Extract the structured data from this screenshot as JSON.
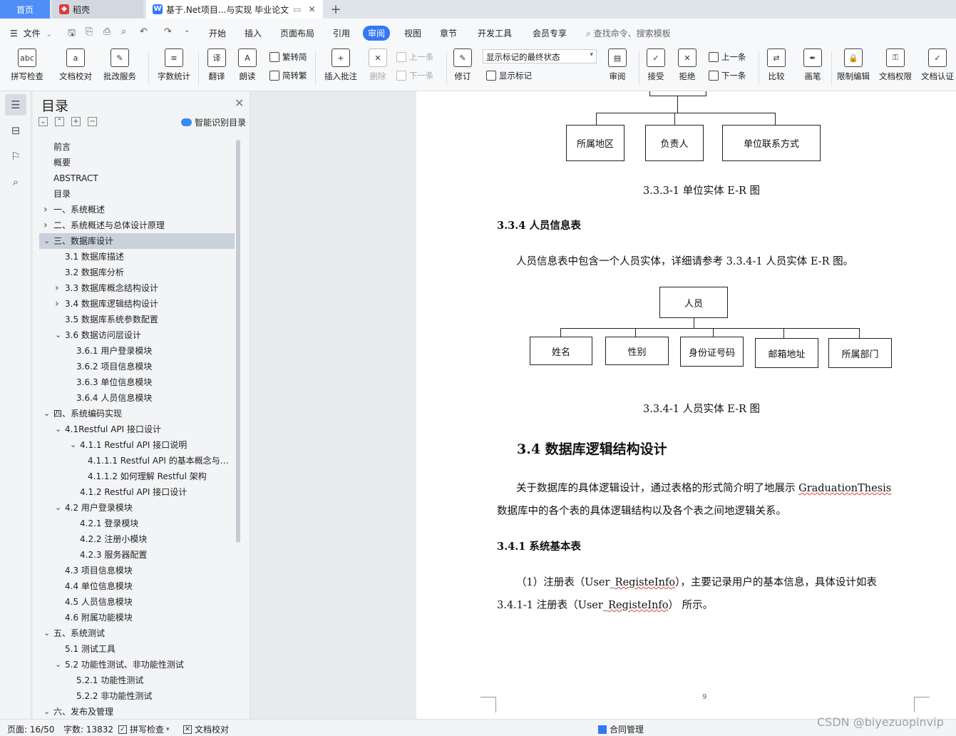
{
  "tabs": {
    "home": "首页",
    "daoke": "稻壳",
    "doc": "基于.Net项目...与实现 毕业论文",
    "new_tab": "+"
  },
  "menu": {
    "file": "文件",
    "items": [
      "开始",
      "插入",
      "页面布局",
      "引用",
      "审阅",
      "视图",
      "章节",
      "开发工具",
      "会员专享"
    ],
    "search": "查找命令、搜索模板"
  },
  "ribbon": {
    "spell": "拼写检查",
    "proof": "文档校对",
    "batch": "批改服务",
    "wordcount": "字数统计",
    "translate": "翻译",
    "read": "朗读",
    "to_simplified": "繁转简",
    "to_traditional": "简转繁",
    "insert_comment": "插入批注",
    "delete": "删除",
    "prev_comment": "上一条",
    "next_comment": "下一条",
    "revise": "修订",
    "markup_state": "显示标记的最终状态",
    "show_markup": "显示标记",
    "review": "审阅",
    "accept": "接受",
    "reject": "拒绝",
    "prev": "上一条",
    "next": "下一条",
    "compare": "比较",
    "pen": "画笔",
    "restrict_edit": "限制编辑",
    "doc_permission": "文档权限",
    "doc_cert": "文档认证"
  },
  "toc": {
    "title": "目录",
    "smart": "智能识别目录",
    "items": [
      {
        "label": "前言",
        "level": 0,
        "chev": ""
      },
      {
        "label": "概要",
        "level": 0,
        "chev": ""
      },
      {
        "label": "ABSTRACT",
        "level": 0,
        "chev": ""
      },
      {
        "label": "目录",
        "level": 0,
        "chev": ""
      },
      {
        "label": "一、系统概述",
        "level": 0,
        "chev": "right"
      },
      {
        "label": "二、系统概述与总体设计原理",
        "level": 0,
        "chev": "right"
      },
      {
        "label": "三、数据库设计",
        "level": 0,
        "chev": "down",
        "selected": true
      },
      {
        "label": "3.1 数据库描述",
        "level": 1,
        "chev": ""
      },
      {
        "label": "3.2 数据库分析",
        "level": 1,
        "chev": ""
      },
      {
        "label": "3.3 数据库概念结构设计",
        "level": 1,
        "chev": "right"
      },
      {
        "label": "3.4 数据库逻辑结构设计",
        "level": 1,
        "chev": "right"
      },
      {
        "label": "3.5 数据库系统参数配置",
        "level": 1,
        "chev": ""
      },
      {
        "label": "3.6 数据访问层设计",
        "level": 1,
        "chev": "down"
      },
      {
        "label": "3.6.1  用户登录模块",
        "level": 2,
        "chev": ""
      },
      {
        "label": "3.6.2  项目信息模块",
        "level": 2,
        "chev": ""
      },
      {
        "label": "3.6.3  单位信息模块",
        "level": 2,
        "chev": ""
      },
      {
        "label": "3.6.4  人员信息模块",
        "level": 2,
        "chev": ""
      },
      {
        "label": "四、系统编码实现",
        "level": 0,
        "chev": "down"
      },
      {
        "label": "4.1Restful API 接口设计",
        "level": 1,
        "chev": "down"
      },
      {
        "label": "4.1.1 Restful API 接口说明",
        "level": 2,
        "chev": "down",
        "shift": true
      },
      {
        "label": "4.1.1.1 Restful API 的基本概念与…",
        "level": 3,
        "chev": ""
      },
      {
        "label": "4.1.1.2  如何理解 Restful 架构",
        "level": 3,
        "chev": ""
      },
      {
        "label": "4.1.2 Restful API 接口设计",
        "level": 2,
        "chev": "",
        "shift": true
      },
      {
        "label": "4.2 用户登录模块",
        "level": 1,
        "chev": "down"
      },
      {
        "label": "4.2.1 登录模块",
        "level": 2,
        "chev": "",
        "shift": true
      },
      {
        "label": "4.2.2 注册小模块",
        "level": 2,
        "chev": "",
        "shift": true
      },
      {
        "label": "4.2.3 服务器配置",
        "level": 2,
        "chev": "",
        "shift": true
      },
      {
        "label": "4.3 项目信息模块",
        "level": 1,
        "chev": ""
      },
      {
        "label": "4.4 单位信息模块",
        "level": 1,
        "chev": ""
      },
      {
        "label": "4.5 人员信息模块",
        "level": 1,
        "chev": ""
      },
      {
        "label": "4.6 附属功能模块",
        "level": 1,
        "chev": ""
      },
      {
        "label": "五、系统测试",
        "level": 0,
        "chev": "down"
      },
      {
        "label": "5.1 测试工具",
        "level": 1,
        "chev": ""
      },
      {
        "label": "5.2 功能性测试、非功能性测试",
        "level": 1,
        "chev": "down"
      },
      {
        "label": "5.2.1  功能性测试",
        "level": 2,
        "chev": ""
      },
      {
        "label": "5.2.2  非功能性测试",
        "level": 2,
        "chev": ""
      },
      {
        "label": "六、发布及管理",
        "level": 0,
        "chev": "down"
      }
    ]
  },
  "doc": {
    "er1": {
      "boxes": [
        "所属地区",
        "负责人",
        "单位联系方式"
      ],
      "caption": "3.3.3-1 单位实体 E-R 图"
    },
    "h334": "3.3.4 人员信息表",
    "p334": "人员信息表中包含一个人员实体，详细请参考 3.3.4-1 人员实体 E-R 图。",
    "er2": {
      "root": "人员",
      "boxes": [
        "姓名",
        "性别",
        "身份证号码",
        "邮箱地址",
        "所属部门"
      ],
      "caption": "3.3.4-1 人员实体 E-R 图"
    },
    "h34": "3.4 数据库逻辑结构设计",
    "p34_line1_a": "关于数据库的具体逻辑设计，通过表格的形式简介明了地展示 ",
    "p34_line1_b": "GraduationThesis",
    "p34_line2": "数据库中的各个表的具体逻辑结构以及各个表之间地逻辑关系。",
    "h341": "3.4.1 系统基本表",
    "p341_line1_a": "（1）注册表（User_",
    "p341_line1_b": "RegisteInfo",
    "p341_line1_c": "），主要记录用户的基本信息，具体设计如表",
    "p341_line2_a": "3.4.1-1 注册表（User_",
    "p341_line2_b": "RegisteInfo",
    "p341_line2_c": "） 所示。",
    "page_number": "9"
  },
  "status": {
    "page": "页面: 16/50",
    "words": "字数: 13832",
    "spell": "拼写检查",
    "proof": "文档校对",
    "contract": "合同管理"
  },
  "watermark": "CSDN @biyezuopinvip"
}
